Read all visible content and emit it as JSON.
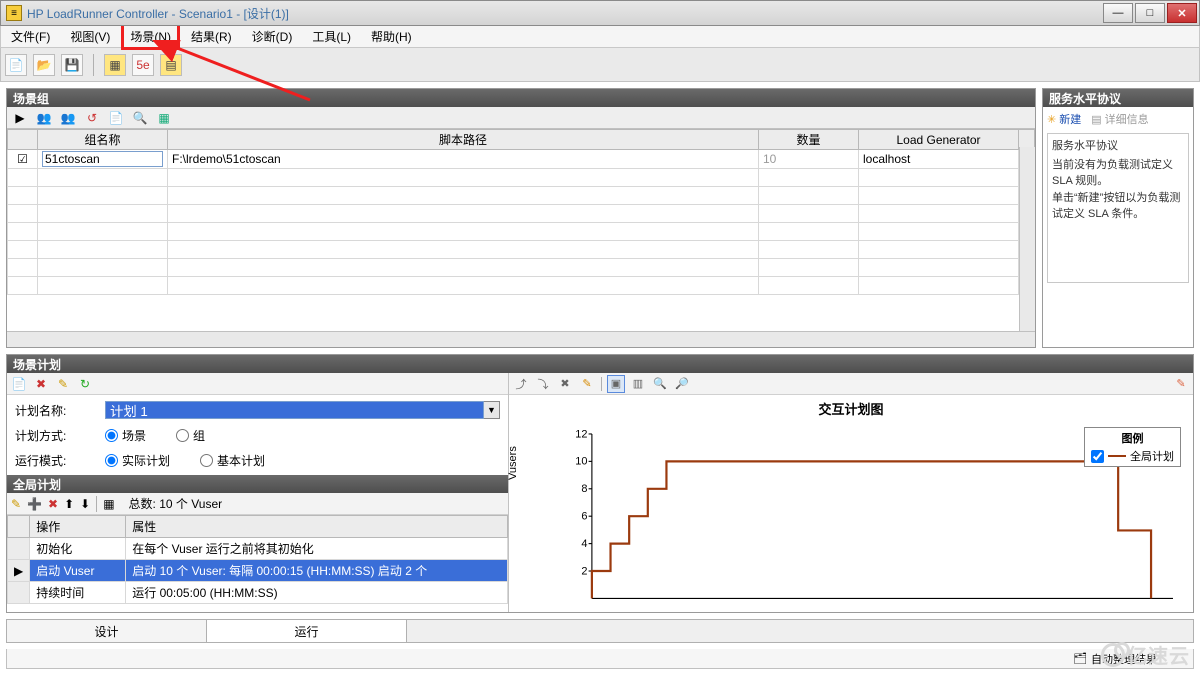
{
  "titlebar": {
    "title": "HP LoadRunner Controller - Scenario1 - [设计(1)]"
  },
  "menu": {
    "file": "文件(F)",
    "view": "视图(V)",
    "scenario": "场景(N)",
    "results": "结果(R)",
    "diagnose": "诊断(D)",
    "tools": "工具(L)",
    "help": "帮助(H)"
  },
  "sgroup": {
    "title": "场景组",
    "headers": {
      "chk": "",
      "name": "组名称",
      "path": "脚本路径",
      "qty": "数量",
      "lg": "Load Generator"
    },
    "row": {
      "name": "51ctoscan",
      "path": "F:\\lrdemo\\51ctoscan",
      "qty": "10",
      "lg": "localhost"
    }
  },
  "sla": {
    "title": "服务水平协议",
    "new": "新建",
    "details": "详细信息",
    "boxtitle": "服务水平协议",
    "boxtext": "当前没有为负载测试定义 SLA 规则。\n单击“新建”按钮以为负载测试定义 SLA 条件。"
  },
  "plan": {
    "title": "场景计划",
    "name_label": "计划名称:",
    "name_value": "计划 1",
    "mode_label": "计划方式:",
    "mode_opt1": "场景",
    "mode_opt2": "组",
    "run_label": "运行模式:",
    "run_opt1": "实际计划",
    "run_opt2": "基本计划",
    "global_title": "全局计划",
    "total": "总数: 10 个 Vuser",
    "cols": {
      "op": "操作",
      "attr": "属性"
    },
    "rows": [
      {
        "op": "初始化",
        "attr": "在每个 Vuser 运行之前将其初始化"
      },
      {
        "op": "启动 Vuser",
        "attr": "启动 10 个 Vuser: 每隔 00:00:15 (HH:MM:SS) 启动 2 个"
      },
      {
        "op": "持续时间",
        "attr": "运行 00:05:00 (HH:MM:SS)"
      }
    ]
  },
  "chart": {
    "title": "交互计划图",
    "ylabel": "Vusers",
    "legend_title": "图例",
    "legend_item": "全局计划"
  },
  "tabs": {
    "design": "设计",
    "run": "运行"
  },
  "status": {
    "auto": "自动整理结果"
  },
  "watermark": "亿速云",
  "chart_data": {
    "type": "line",
    "title": "交互计划图",
    "xlabel": "",
    "ylabel": "Vusers",
    "ylim": [
      0,
      12
    ],
    "yticks": [
      2,
      4,
      6,
      8,
      10,
      12
    ],
    "series": [
      {
        "name": "全局计划",
        "color": "#9b3a0e",
        "x_seconds": [
          0,
          15,
          30,
          45,
          60,
          75,
          375,
          375,
          405
        ],
        "y": [
          0,
          2,
          4,
          6,
          8,
          10,
          10,
          5,
          0
        ]
      }
    ],
    "note": "x is elapsed seconds; 5 ramp-up steps of 2 Vusers every 15s to 10, hold 300s, then drop"
  }
}
